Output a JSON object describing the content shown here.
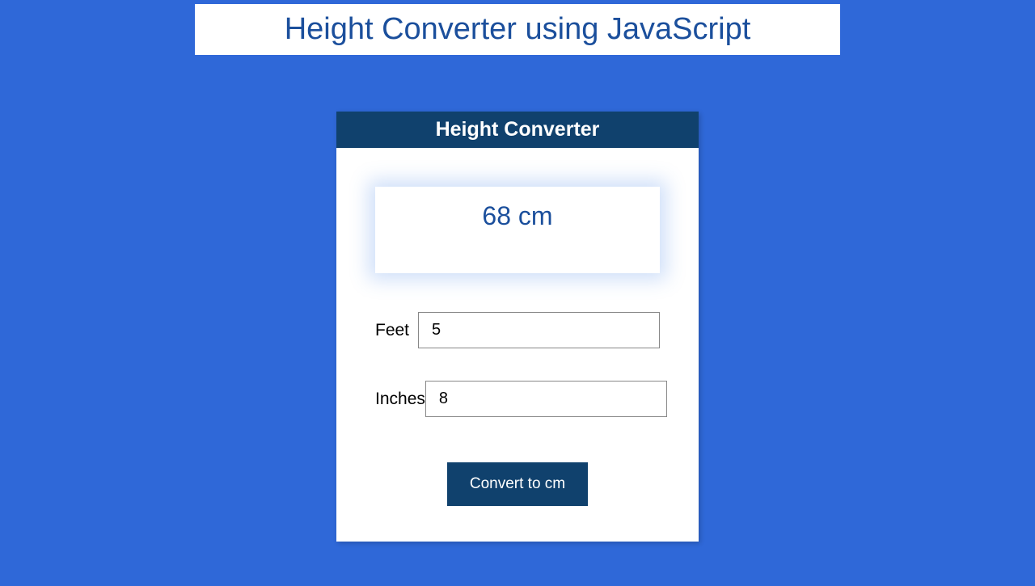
{
  "page": {
    "title": "Height Converter using JavaScript"
  },
  "card": {
    "header": "Height Converter",
    "result": "68 cm",
    "feet": {
      "label": "Feet",
      "value": "5"
    },
    "inches": {
      "label": "Inches",
      "value": "8"
    },
    "button_label": "Convert to cm"
  }
}
